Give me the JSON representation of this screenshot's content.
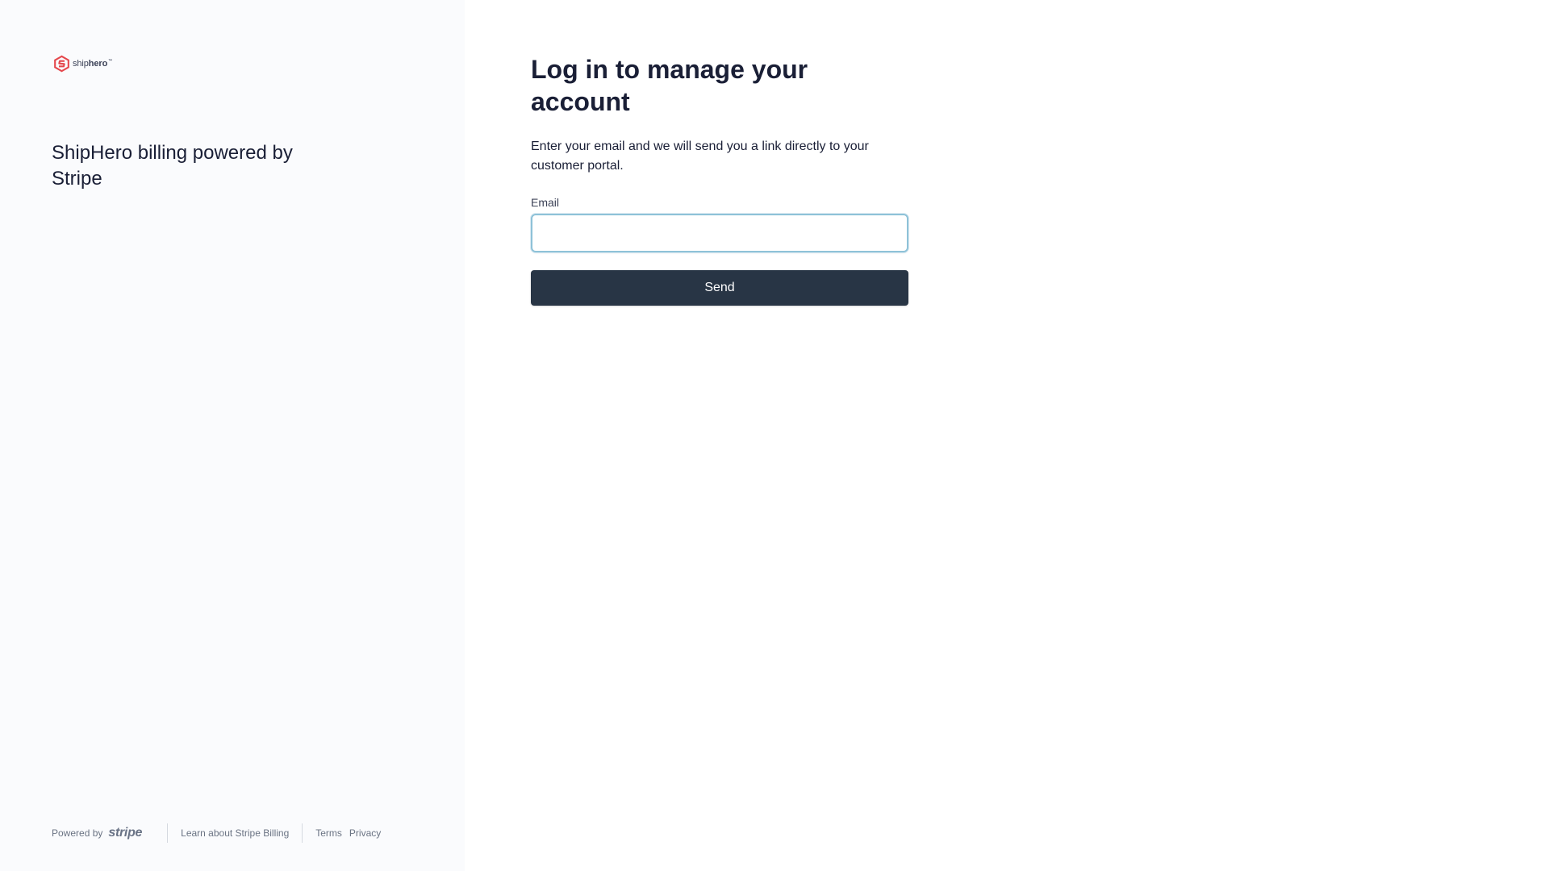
{
  "brand": {
    "logo_icon": "shiphero-hexagon-logo",
    "logo_part_ship": "ship",
    "logo_part_hero": "hero",
    "logo_trademark": "™",
    "accent_color": "#e5484d"
  },
  "left_panel": {
    "title": "ShipHero billing powered by Stripe"
  },
  "footer": {
    "powered_by": "Powered by",
    "stripe_logo_text": "stripe",
    "learn_link": "Learn about Stripe Billing",
    "terms_link": "Terms",
    "privacy_link": "Privacy"
  },
  "form": {
    "heading": "Log in to manage your account",
    "description": "Enter your email and we will send you a link directly to your customer portal.",
    "email_label": "Email",
    "email_value": "",
    "email_placeholder": "",
    "submit_label": "Send",
    "button_color": "#283545"
  }
}
